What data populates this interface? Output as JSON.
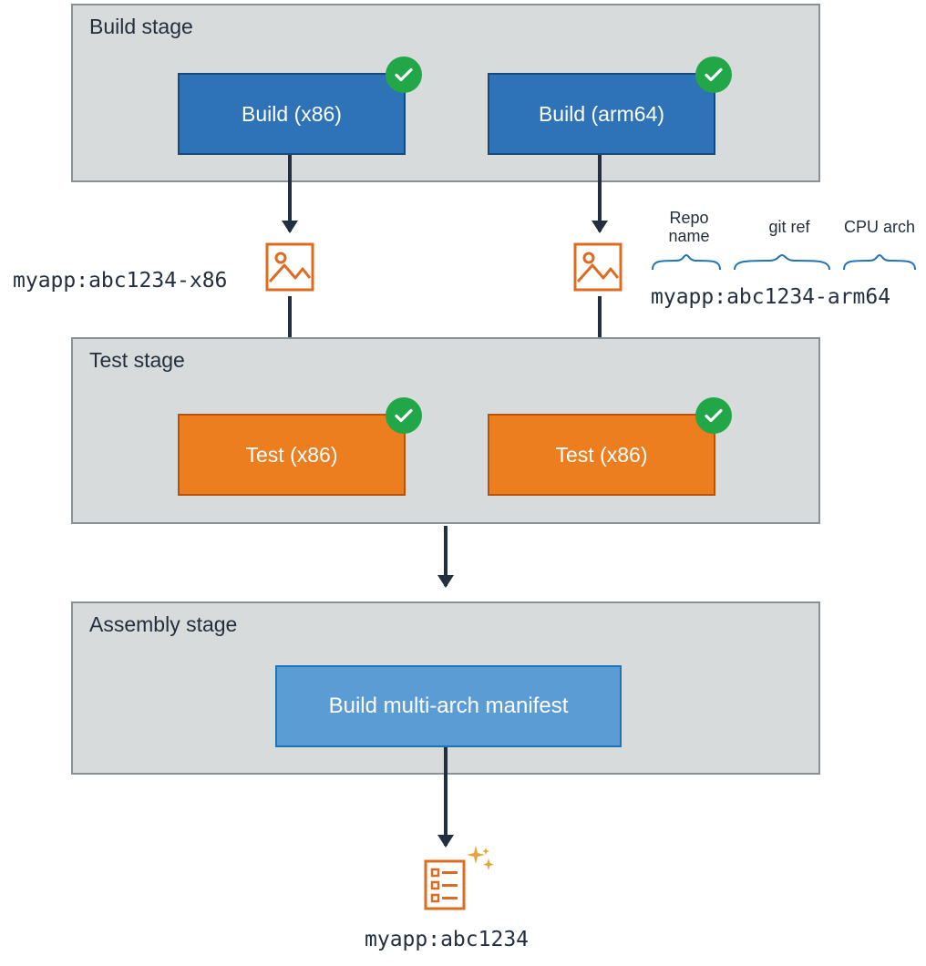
{
  "stages": {
    "build": {
      "title": "Build stage",
      "jobs": {
        "x86": "Build (x86)",
        "arm64": "Build (arm64)"
      }
    },
    "test": {
      "title": "Test stage",
      "jobs": {
        "x86": "Test (x86)",
        "arm64": "Test (x86)"
      }
    },
    "assembly": {
      "title": "Assembly stage",
      "jobs": {
        "manifest": "Build multi-arch manifest"
      }
    }
  },
  "tags": {
    "x86": "myapp:abc1234-x86",
    "arm64": "myapp:abc1234-arm64",
    "final": "myapp:abc1234"
  },
  "annotations": {
    "repo": "Repo name",
    "git_ref": "git ref",
    "cpu_arch": "CPU arch"
  },
  "colors": {
    "stage_bg": "#d7dbdb",
    "stage_border": "#879196",
    "build_fill": "#2e73b8",
    "test_fill": "#ed7e20",
    "assembly_fill": "#5c9cd4",
    "success": "#22a748",
    "icon": "#de6b1f",
    "brace": "#1f73b7"
  }
}
